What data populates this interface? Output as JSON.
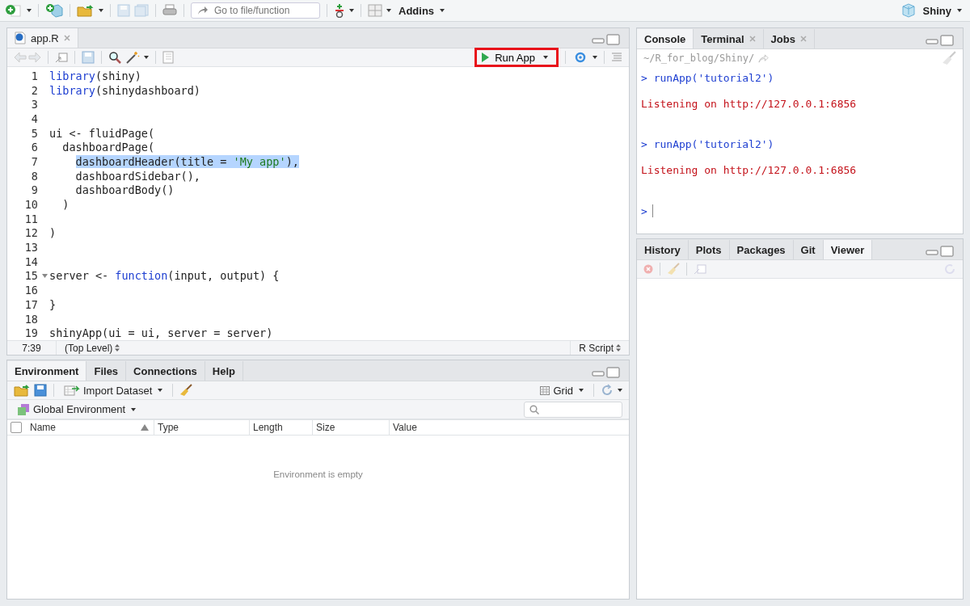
{
  "toolbar": {
    "goto_placeholder": "Go to file/function",
    "addins": "Addins",
    "project": "Shiny"
  },
  "editor": {
    "tabs": [
      {
        "label": "app.R",
        "selected": true
      }
    ],
    "run_button": {
      "label": "Run App",
      "highlighted": true
    },
    "lines": [
      {
        "number": "1",
        "fold": false,
        "tokens": [
          {
            "text": "library",
            "kind": "function",
            "selected": false
          },
          {
            "text": "(shiny)",
            "kind": "plain",
            "selected": false
          }
        ]
      },
      {
        "number": "2",
        "fold": false,
        "tokens": [
          {
            "text": "library",
            "kind": "function",
            "selected": false
          },
          {
            "text": "(shinydashboard)",
            "kind": "plain",
            "selected": false
          }
        ]
      },
      {
        "number": "3",
        "fold": false
      },
      {
        "number": "4",
        "fold": false
      },
      {
        "number": "5",
        "fold": false,
        "tokens": [
          {
            "text": "ui <- fluidPage(",
            "kind": "plain",
            "selected": false
          }
        ]
      },
      {
        "number": "6",
        "fold": false,
        "tokens": [
          {
            "text": "  dashboardPage(",
            "kind": "plain",
            "selected": false
          }
        ]
      },
      {
        "number": "7",
        "fold": false,
        "tokens": [
          {
            "text": "    dashboardHeader(title = ",
            "kind": "plain",
            "selected": true
          },
          {
            "text": "'My app'",
            "kind": "string",
            "selected": true
          },
          {
            "text": "),",
            "kind": "plain",
            "selected": true
          }
        ]
      },
      {
        "number": "8",
        "fold": false,
        "tokens": [
          {
            "text": "    dashboardSidebar(),",
            "kind": "plain",
            "selected": false
          }
        ]
      },
      {
        "number": "9",
        "fold": false,
        "tokens": [
          {
            "text": "    dashboardBody()",
            "kind": "plain",
            "selected": false
          }
        ]
      },
      {
        "number": "10",
        "fold": false,
        "tokens": [
          {
            "text": "  )",
            "kind": "plain",
            "selected": false
          }
        ]
      },
      {
        "number": "11",
        "fold": false
      },
      {
        "number": "12",
        "fold": false,
        "tokens": [
          {
            "text": ")",
            "kind": "plain",
            "selected": false
          }
        ]
      },
      {
        "number": "13",
        "fold": false
      },
      {
        "number": "14",
        "fold": false
      },
      {
        "number": "15",
        "fold": true,
        "tokens": [
          {
            "text": "server <- ",
            "kind": "plain",
            "selected": false
          },
          {
            "text": "function",
            "kind": "function",
            "selected": false
          },
          {
            "text": "(input, output) {",
            "kind": "plain",
            "selected": false
          }
        ]
      },
      {
        "number": "16",
        "fold": false
      },
      {
        "number": "17",
        "fold": false,
        "tokens": [
          {
            "text": "}",
            "kind": "plain",
            "selected": false
          }
        ]
      },
      {
        "number": "18",
        "fold": false
      },
      {
        "number": "19",
        "fold": false,
        "tokens": [
          {
            "text": "shinyApp(ui = ui, server = server)",
            "kind": "plain",
            "selected": false
          }
        ]
      }
    ],
    "status": {
      "position": "7:39",
      "scope": "(Top Level)",
      "file_type": "R Script"
    }
  },
  "environment": {
    "tabs": [
      {
        "label": "Environment",
        "selected": true
      },
      {
        "label": "Files",
        "selected": false
      },
      {
        "label": "Connections",
        "selected": false
      },
      {
        "label": "Help",
        "selected": false
      }
    ],
    "select_all_checked": false,
    "import_button": "Import Dataset",
    "view_button": "Grid",
    "scope": "Global Environment",
    "columns": [
      {
        "label": "Name",
        "sorted": true
      },
      {
        "label": "Type",
        "sorted": false
      },
      {
        "label": "Length",
        "sorted": false
      },
      {
        "label": "Size",
        "sorted": false
      },
      {
        "label": "Value",
        "sorted": false
      }
    ],
    "empty_message": "Environment is empty"
  },
  "console": {
    "tabs": [
      {
        "label": "Console",
        "selected": true,
        "closable": false
      },
      {
        "label": "Terminal",
        "selected": false,
        "closable": true
      },
      {
        "label": "Jobs",
        "selected": false,
        "closable": true
      }
    ],
    "path": "~/R_for_blog/Shiny/",
    "lines": [
      {
        "kind": "input",
        "text": "> runApp('tutorial2')"
      },
      {
        "kind": "output",
        "text": "Listening on http://127.0.0.1:6856"
      },
      {
        "kind": "input",
        "text": "> runApp('tutorial2')"
      },
      {
        "kind": "output",
        "text": "Listening on http://127.0.0.1:6856"
      },
      {
        "kind": "prompt",
        "text": ">"
      }
    ]
  },
  "viewer": {
    "tabs": [
      {
        "label": "History",
        "selected": false
      },
      {
        "label": "Plots",
        "selected": false
      },
      {
        "label": "Packages",
        "selected": false
      },
      {
        "label": "Git",
        "selected": false
      },
      {
        "label": "Viewer",
        "selected": true
      }
    ]
  }
}
